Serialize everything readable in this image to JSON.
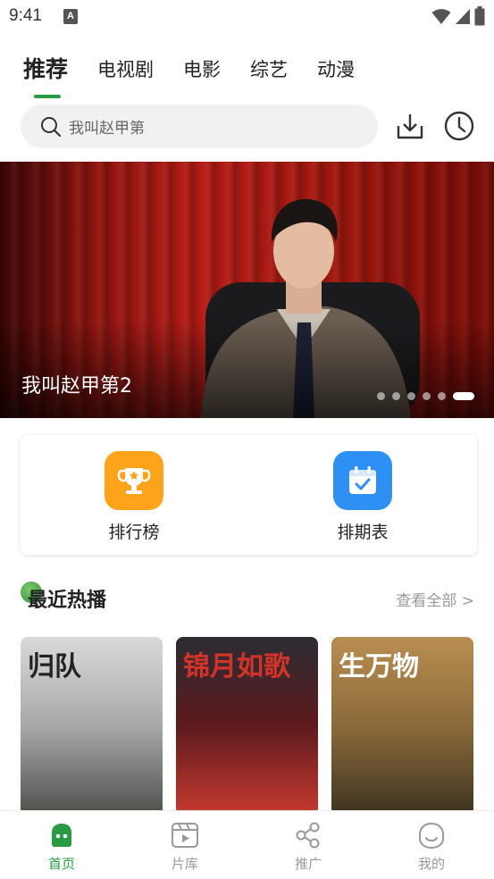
{
  "status_bar": {
    "time": "9:41",
    "notification_badge": "A"
  },
  "tabs": [
    {
      "label": "推荐",
      "active": true
    },
    {
      "label": "电视剧",
      "active": false
    },
    {
      "label": "电影",
      "active": false
    },
    {
      "label": "综艺",
      "active": false
    },
    {
      "label": "动漫",
      "active": false
    }
  ],
  "search": {
    "placeholder": "我叫赵甲第"
  },
  "banner": {
    "title": "我叫赵甲第2",
    "slide_count": 6,
    "active_slide": 6
  },
  "shortcuts": [
    {
      "label": "排行榜",
      "icon": "trophy-icon",
      "color": "#ffa31a"
    },
    {
      "label": "排期表",
      "icon": "calendar-check-icon",
      "color": "#2e8ff5"
    }
  ],
  "section": {
    "title": "最近热播",
    "more": "查看全部 >"
  },
  "posters": [
    {
      "title": "归队",
      "colors": [
        "#d9d9d9",
        "#a7a9a8",
        "#4d4f4b"
      ]
    },
    {
      "title": "锦月如歌",
      "colors": [
        "#2b2c33",
        "#5e1a1d",
        "#c83a2f"
      ]
    },
    {
      "title": "生万物",
      "colors": [
        "#b98e52",
        "#8a6a3a",
        "#3d3320"
      ]
    }
  ],
  "bottom_nav": [
    {
      "label": "首页",
      "icon": "home-icon",
      "active": true
    },
    {
      "label": "片库",
      "icon": "film-library-icon",
      "active": false
    },
    {
      "label": "推广",
      "icon": "share-icon",
      "active": false
    },
    {
      "label": "我的",
      "icon": "profile-icon",
      "active": false
    }
  ],
  "colors": {
    "accent": "#2a9b45"
  }
}
